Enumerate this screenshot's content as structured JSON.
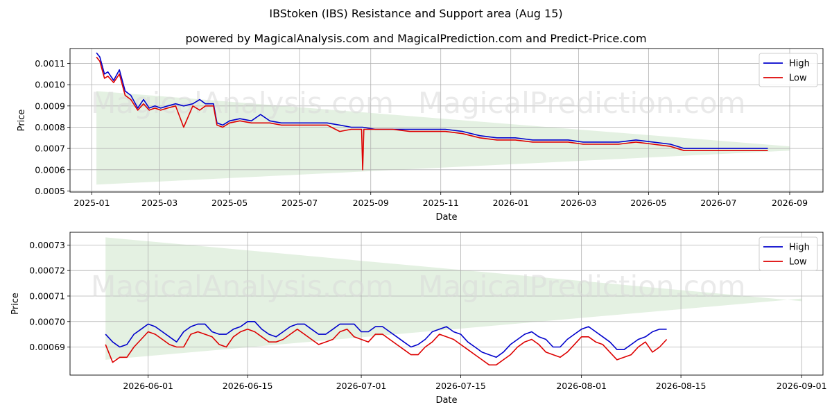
{
  "figure": {
    "title": "IBStoken (IBS) Resistance and Support area (Aug 15)",
    "subtitle": "powered by MagicalAnalysis.com and MagicalPrediction.com and Predict-Price.com",
    "watermarks": [
      "MagicalAnalysis.com",
      "MagicalPrediction.com"
    ]
  },
  "colors": {
    "high": "#0000cc",
    "low": "#dd0000",
    "band": "#d5ead2",
    "grid": "#b0b0b0"
  },
  "chart_data": [
    {
      "type": "line",
      "xlabel": "Date",
      "ylabel": "Price",
      "grid": true,
      "legend": "top-right",
      "legend_entries": [
        "High",
        "Low"
      ],
      "xlim": [
        "2024-12-13",
        "2026-09-30"
      ],
      "ylim": [
        0.000495,
        0.00117
      ],
      "x_ticks": [
        "2025-01",
        "2025-03",
        "2025-05",
        "2025-07",
        "2025-09",
        "2025-11",
        "2026-01",
        "2026-03",
        "2026-05",
        "2026-07",
        "2026-09"
      ],
      "x_tick_dates": [
        "2025-01-01",
        "2025-03-01",
        "2025-05-01",
        "2025-07-01",
        "2025-09-01",
        "2025-11-01",
        "2026-01-01",
        "2026-03-01",
        "2026-05-01",
        "2026-07-01",
        "2026-09-01"
      ],
      "y_ticks": [
        0.0005,
        0.0006,
        0.0007,
        0.0008,
        0.0009,
        0.001,
        0.0011
      ],
      "y_tick_labels": [
        "0.0005",
        "0.0006",
        "0.0007",
        "0.0008",
        "0.0009",
        "0.0010",
        "0.0011"
      ],
      "band": {
        "start": "2025-01-05",
        "end": "2026-09-01",
        "upper": [
          0.00097,
          0.00071
        ],
        "lower": [
          0.00053,
          0.00069
        ]
      },
      "series": [
        {
          "name": "High",
          "color": "#0000cc",
          "x": [
            "2025-01-05",
            "2025-01-08",
            "2025-01-12",
            "2025-01-15",
            "2025-01-20",
            "2025-01-25",
            "2025-01-30",
            "2025-02-04",
            "2025-02-10",
            "2025-02-15",
            "2025-02-20",
            "2025-02-25",
            "2025-03-02",
            "2025-03-08",
            "2025-03-15",
            "2025-03-22",
            "2025-03-30",
            "2025-04-05",
            "2025-04-10",
            "2025-04-17",
            "2025-04-20",
            "2025-04-25",
            "2025-05-01",
            "2025-05-10",
            "2025-05-20",
            "2025-05-28",
            "2025-06-05",
            "2025-06-15",
            "2025-06-25",
            "2025-07-05",
            "2025-07-15",
            "2025-07-25",
            "2025-08-05",
            "2025-08-15",
            "2025-08-25",
            "2025-09-05",
            "2025-09-20",
            "2025-10-05",
            "2025-10-20",
            "2025-11-05",
            "2025-11-20",
            "2025-12-05",
            "2025-12-20",
            "2026-01-05",
            "2026-01-20",
            "2026-02-05",
            "2026-02-20",
            "2026-03-05",
            "2026-03-20",
            "2026-04-05",
            "2026-04-20",
            "2026-05-05",
            "2026-05-20",
            "2026-06-01",
            "2026-06-15",
            "2026-07-01",
            "2026-07-15",
            "2026-08-01",
            "2026-08-13"
          ],
          "values": [
            0.00115,
            0.00113,
            0.00105,
            0.00106,
            0.00102,
            0.00107,
            0.00097,
            0.00095,
            0.00089,
            0.00093,
            0.00089,
            0.0009,
            0.00089,
            0.0009,
            0.00091,
            0.0009,
            0.00091,
            0.00093,
            0.00091,
            0.00091,
            0.00082,
            0.00081,
            0.00083,
            0.00084,
            0.00083,
            0.00086,
            0.00083,
            0.00082,
            0.00082,
            0.00082,
            0.00082,
            0.00082,
            0.00081,
            0.0008,
            0.0008,
            0.00079,
            0.00079,
            0.00079,
            0.00079,
            0.00079,
            0.00078,
            0.00076,
            0.00075,
            0.00075,
            0.00074,
            0.00074,
            0.00074,
            0.00073,
            0.00073,
            0.00073,
            0.00074,
            0.00073,
            0.00072,
            0.0007,
            0.0007,
            0.0007,
            0.0007,
            0.0007,
            0.0007
          ]
        },
        {
          "name": "Low",
          "color": "#dd0000",
          "x": [
            "2025-01-05",
            "2025-01-08",
            "2025-01-12",
            "2025-01-15",
            "2025-01-20",
            "2025-01-25",
            "2025-01-30",
            "2025-02-04",
            "2025-02-10",
            "2025-02-15",
            "2025-02-20",
            "2025-02-25",
            "2025-03-02",
            "2025-03-08",
            "2025-03-15",
            "2025-03-22",
            "2025-03-30",
            "2025-04-05",
            "2025-04-10",
            "2025-04-17",
            "2025-04-20",
            "2025-04-25",
            "2025-05-01",
            "2025-05-10",
            "2025-05-20",
            "2025-05-28",
            "2025-06-05",
            "2025-06-15",
            "2025-06-25",
            "2025-07-05",
            "2025-07-15",
            "2025-07-25",
            "2025-08-05",
            "2025-08-15",
            "2025-08-24",
            "2025-08-25",
            "2025-08-26",
            "2025-09-05",
            "2025-09-20",
            "2025-10-05",
            "2025-10-20",
            "2025-11-05",
            "2025-11-20",
            "2025-12-05",
            "2025-12-20",
            "2026-01-05",
            "2026-01-20",
            "2026-02-05",
            "2026-02-20",
            "2026-03-05",
            "2026-03-20",
            "2026-04-05",
            "2026-04-20",
            "2026-05-05",
            "2026-05-20",
            "2026-06-01",
            "2026-06-15",
            "2026-07-01",
            "2026-07-15",
            "2026-08-01",
            "2026-08-13"
          ],
          "values": [
            0.00113,
            0.00111,
            0.00103,
            0.00104,
            0.00101,
            0.00105,
            0.00095,
            0.00093,
            0.00088,
            0.00091,
            0.00088,
            0.00089,
            0.00088,
            0.00089,
            0.0009,
            0.0008,
            0.0009,
            0.00088,
            0.0009,
            0.0009,
            0.00081,
            0.0008,
            0.00082,
            0.00083,
            0.00082,
            0.00082,
            0.00082,
            0.00081,
            0.00081,
            0.00081,
            0.00081,
            0.00081,
            0.00078,
            0.00079,
            0.00079,
            0.0006,
            0.00079,
            0.00079,
            0.00079,
            0.00078,
            0.00078,
            0.00078,
            0.00077,
            0.00075,
            0.00074,
            0.00074,
            0.00073,
            0.00073,
            0.00073,
            0.00072,
            0.00072,
            0.00072,
            0.00073,
            0.00072,
            0.00071,
            0.00069,
            0.00069,
            0.00069,
            0.00069,
            0.00069,
            0.00069
          ]
        }
      ]
    },
    {
      "type": "line",
      "xlabel": "Date",
      "ylabel": "Price",
      "grid": true,
      "legend": "top-right",
      "legend_entries": [
        "High",
        "Low"
      ],
      "xlim": [
        "2026-05-21",
        "2026-09-04"
      ],
      "ylim": [
        0.000679,
        0.000735
      ],
      "x_ticks": [
        "2026-06-01",
        "2026-06-15",
        "2026-07-01",
        "2026-07-15",
        "2026-08-01",
        "2026-08-15",
        "2026-09-01"
      ],
      "y_ticks": [
        0.00069,
        0.0007,
        0.00071,
        0.00072,
        0.00073
      ],
      "y_tick_labels": [
        "0.00069",
        "0.00070",
        "0.00071",
        "0.00072",
        "0.00073"
      ],
      "band": {
        "start": "2026-05-26",
        "end": "2026-09-01",
        "upper": [
          0.000733,
          0.000708
        ],
        "lower": [
          0.000685,
          0.000709
        ]
      },
      "series": [
        {
          "name": "High",
          "color": "#0000cc",
          "start": "2026-05-26",
          "values": [
            0.000695,
            0.000692,
            0.00069,
            0.000691,
            0.000695,
            0.000697,
            0.000699,
            0.000698,
            0.000696,
            0.000694,
            0.000692,
            0.000696,
            0.000698,
            0.000699,
            0.000699,
            0.000696,
            0.000695,
            0.000695,
            0.000697,
            0.000698,
            0.0007,
            0.0007,
            0.000697,
            0.000695,
            0.000694,
            0.000696,
            0.000698,
            0.000699,
            0.000699,
            0.000697,
            0.000695,
            0.000695,
            0.000697,
            0.000699,
            0.000699,
            0.000699,
            0.000696,
            0.000696,
            0.000698,
            0.000698,
            0.000696,
            0.000694,
            0.000692,
            0.00069,
            0.000691,
            0.000693,
            0.000696,
            0.000697,
            0.000698,
            0.000696,
            0.000695,
            0.000692,
            0.00069,
            0.000688,
            0.000687,
            0.000686,
            0.000688,
            0.000691,
            0.000693,
            0.000695,
            0.000696,
            0.000694,
            0.000693,
            0.00069,
            0.00069,
            0.000693,
            0.000695,
            0.000697,
            0.000698,
            0.000696,
            0.000694,
            0.000692,
            0.000689,
            0.000689,
            0.000691,
            0.000693,
            0.000694,
            0.000696,
            0.000697,
            0.000697
          ]
        },
        {
          "name": "Low",
          "color": "#dd0000",
          "start": "2026-05-26",
          "values": [
            0.000691,
            0.000684,
            0.000686,
            0.000686,
            0.00069,
            0.000693,
            0.000696,
            0.000695,
            0.000693,
            0.000691,
            0.00069,
            0.00069,
            0.000695,
            0.000696,
            0.000695,
            0.000694,
            0.000691,
            0.00069,
            0.000694,
            0.000696,
            0.000697,
            0.000696,
            0.000694,
            0.000692,
            0.000692,
            0.000693,
            0.000695,
            0.000697,
            0.000695,
            0.000693,
            0.000691,
            0.000692,
            0.000693,
            0.000696,
            0.000697,
            0.000694,
            0.000693,
            0.000692,
            0.000695,
            0.000695,
            0.000693,
            0.000691,
            0.000689,
            0.000687,
            0.000687,
            0.00069,
            0.000692,
            0.000695,
            0.000694,
            0.000693,
            0.000691,
            0.000689,
            0.000687,
            0.000685,
            0.000683,
            0.000683,
            0.000685,
            0.000687,
            0.00069,
            0.000692,
            0.000693,
            0.000691,
            0.000688,
            0.000687,
            0.000686,
            0.000688,
            0.000691,
            0.000694,
            0.000694,
            0.000692,
            0.000691,
            0.000688,
            0.000685,
            0.000686,
            0.000687,
            0.00069,
            0.000692,
            0.000688,
            0.00069,
            0.000693
          ]
        }
      ]
    }
  ]
}
